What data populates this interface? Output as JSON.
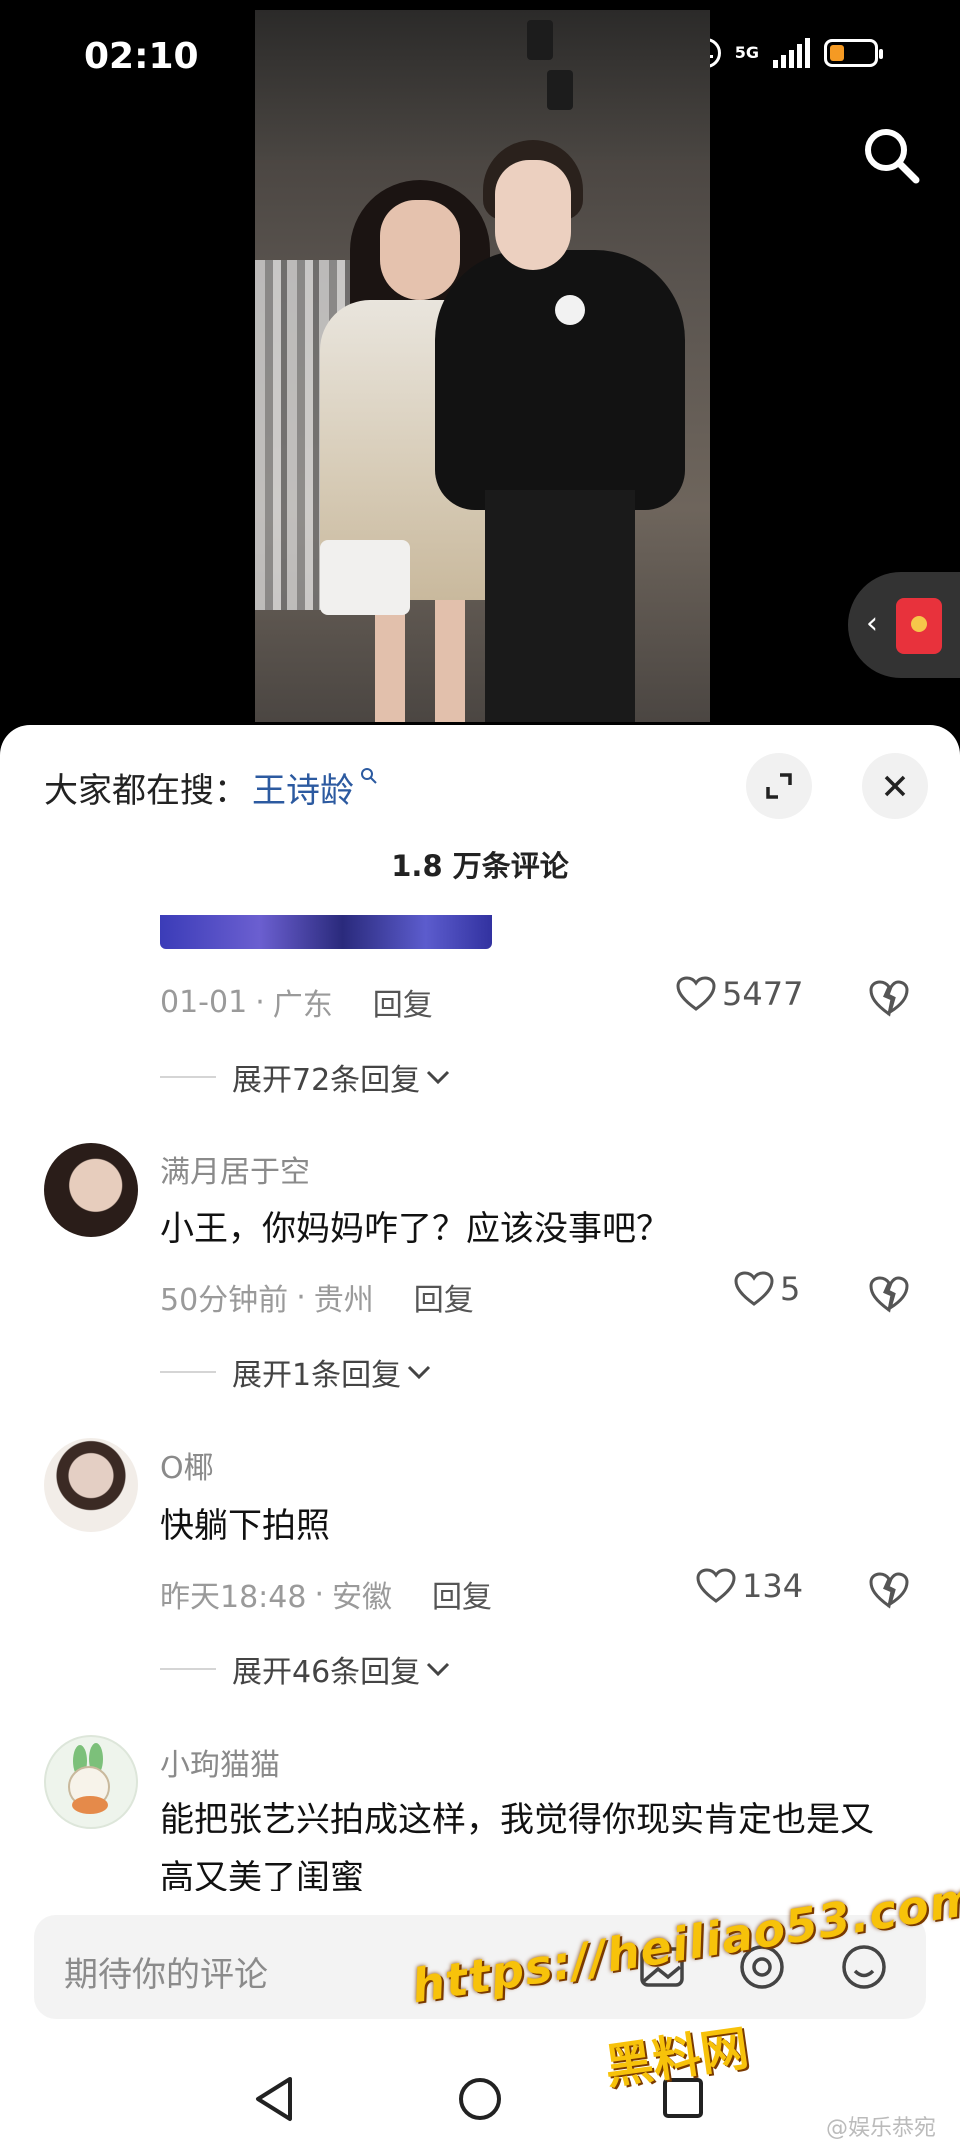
{
  "status_bar": {
    "time": "02:10",
    "network": "5G"
  },
  "search_icon": "search-icon",
  "trending": {
    "label": "大家都在搜：",
    "term": "王诗龄"
  },
  "comments_header": {
    "count_title": "1.8 万条评论"
  },
  "comments": [
    {
      "user": "",
      "text": "",
      "date": "01-01",
      "location": "广东",
      "reply_label": "回复",
      "likes": "5477",
      "expand_label": "展开72条回复"
    },
    {
      "user": "满月居于空",
      "text": "小王，你妈妈咋了？应该没事吧？",
      "date": "50分钟前",
      "location": "贵州",
      "reply_label": "回复",
      "likes": "5",
      "expand_label": "展开1条回复"
    },
    {
      "user": "O椰",
      "text": "快躺下拍照",
      "date": "昨天18:48",
      "location": "安徽",
      "reply_label": "回复",
      "likes": "134",
      "expand_label": "展开46条回复"
    },
    {
      "user": "小玽猫猫",
      "text": "能把张艺兴拍成这样，我觉得你现实肯定也是又高又美了闺蜜"
    }
  ],
  "input": {
    "placeholder": "期待你的评论"
  },
  "watermark": {
    "url": "https://heiliao53.com",
    "name": "黑料网"
  },
  "credit": "@娱乐恭宛",
  "colors": {
    "trend_link": "#2c5aa0",
    "watermark": "#f7c20a",
    "red_packet": "#e8323c"
  }
}
